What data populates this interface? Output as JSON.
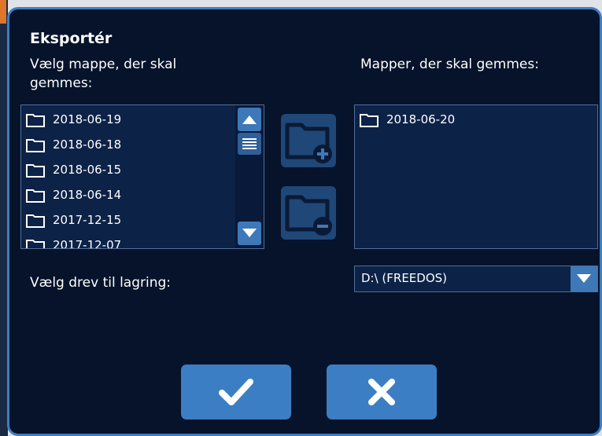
{
  "dialog": {
    "title": "Eksportér",
    "source_label": "Vælg mappe, der skal gemmes:",
    "target_label": "Mapper, der skal gemmes:",
    "drive_label": "Vælg drev til lagring:"
  },
  "source_list": [
    "2018-06-19",
    "2018-06-18",
    "2018-06-15",
    "2018-06-14",
    "2017-12-15",
    "2017-12-07"
  ],
  "target_list": [
    "2018-06-20"
  ],
  "drive": {
    "selected": "D:\\ (FREEDOS)"
  },
  "icons": {
    "folder": "folder-icon",
    "scroll_up": "triangle-up-icon",
    "scroll_thumb": "grip-lines-icon",
    "scroll_down": "triangle-down-icon",
    "add_folder": "folder-plus-icon",
    "remove_folder": "folder-minus-icon",
    "dropdown": "triangle-down-icon",
    "confirm": "checkmark-icon",
    "cancel": "x-icon"
  },
  "colors": {
    "background": "#06132b",
    "border": "#3d7ec2",
    "button": "#3c7ec4",
    "list_bg": "#0d2247"
  }
}
